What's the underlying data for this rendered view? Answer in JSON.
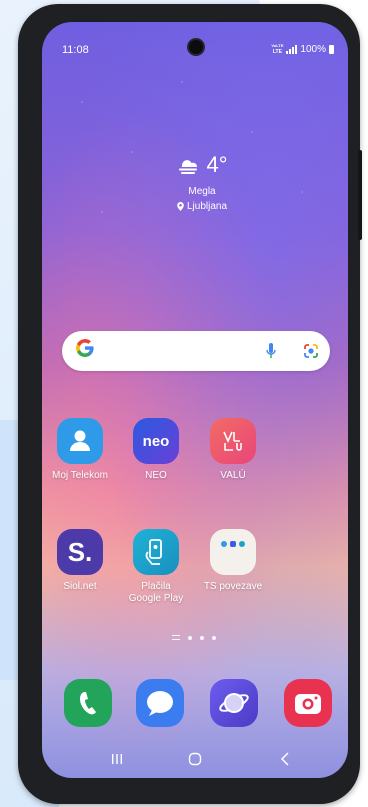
{
  "status_bar": {
    "time": "11:08",
    "volte_top": "VoLTE",
    "lte": "LTE",
    "battery": "100%",
    "icons": [
      "volte-icon",
      "signal-icon",
      "battery-icon"
    ]
  },
  "weather": {
    "icon": "cloud-fog-icon",
    "temperature": "4°",
    "condition": "Megla",
    "location": "Ljubljana",
    "location_icon": "location-pin-icon"
  },
  "search_bar": {
    "logo": "G",
    "icons": [
      "google-logo-icon",
      "microphone-icon",
      "google-lens-icon"
    ]
  },
  "apps": [
    {
      "label": "Moj Telekom",
      "icon": "person-icon",
      "color": "#2f9be8"
    },
    {
      "label": "NEO",
      "icon": "neo-logo-icon",
      "color": "#3d5be6"
    },
    {
      "label": "VALÚ",
      "icon": "valu-logo-icon",
      "color": "#f0566a"
    },
    {
      "label": "Siol.net",
      "icon": "siol-logo-icon",
      "glyph": "S.",
      "color": "#4b3aa8"
    },
    {
      "label": "Plačila\nGoogle Play",
      "label_line1": "Plačila",
      "label_line2": "Google Play",
      "icon": "pay-hand-icon",
      "color": "#1aa3c9"
    },
    {
      "label": "TS povezave",
      "icon": "ts-folder-icon",
      "color": "#f4f1ec"
    }
  ],
  "dock": [
    {
      "name": "phone",
      "icon": "phone-icon",
      "color": "#22a45a"
    },
    {
      "name": "messages",
      "icon": "message-bubble-icon",
      "color": "#3b7df0"
    },
    {
      "name": "internet",
      "icon": "planet-icon",
      "color": "#5a4bd6"
    },
    {
      "name": "camera",
      "icon": "camera-icon",
      "color": "#e8324f"
    }
  ],
  "nav_bar": {
    "icons": [
      "recent-apps-icon",
      "home-icon",
      "back-icon"
    ]
  },
  "colors": {
    "phone_frame": "#1f2024",
    "wallpaper_top": "#6f5fe0",
    "wallpaper_mid": "#ee97a0",
    "wallpaper_bottom": "#8f90e0"
  }
}
